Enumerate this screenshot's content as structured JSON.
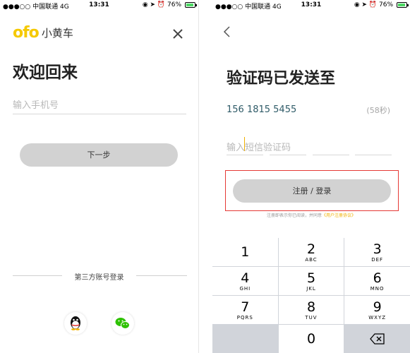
{
  "status_bar": {
    "left": "●●●○○ 中国联通  4G",
    "time": "13:31",
    "right": "◉ ➤ ⏰ 76%",
    "battery_level": 0.76
  },
  "login_screen": {
    "logo_brand": "ofo",
    "logo_name": "小黄车",
    "close_icon": "close-icon",
    "title": "欢迎回来",
    "phone_placeholder": "输入手机号",
    "next_button": "下一步",
    "third_party_label": "第三方账号登录",
    "qq_icon": "qq-icon",
    "wechat_icon": "wechat-icon"
  },
  "verify_screen": {
    "back_icon": "back-chevron-icon",
    "title": "验证码已发送至",
    "phone_number": "156 1815 5455",
    "countdown": "(58秒)",
    "code_placeholder": "输入短信验证码",
    "register_button": "注册 / 登录",
    "terms_prefix": "注册即表示你已阅读，并同意",
    "terms_link": "《用户注册协议》",
    "highlight_color": "#e53935"
  },
  "keypad": {
    "keys": [
      {
        "digit": "1",
        "letters": ""
      },
      {
        "digit": "2",
        "letters": "ABC"
      },
      {
        "digit": "3",
        "letters": "DEF"
      },
      {
        "digit": "4",
        "letters": "GHI"
      },
      {
        "digit": "5",
        "letters": "JKL"
      },
      {
        "digit": "6",
        "letters": "MNO"
      },
      {
        "digit": "7",
        "letters": "PQRS"
      },
      {
        "digit": "8",
        "letters": "TUV"
      },
      {
        "digit": "9",
        "letters": "WXYZ"
      },
      {
        "digit": "",
        "letters": ""
      },
      {
        "digit": "0",
        "letters": ""
      },
      {
        "digit": "",
        "letters": ""
      }
    ],
    "delete_icon": "backspace-icon"
  },
  "colors": {
    "brand_yellow": "#f5c900",
    "button_gray": "#d2d2d2",
    "number_color": "#2f5b68"
  }
}
